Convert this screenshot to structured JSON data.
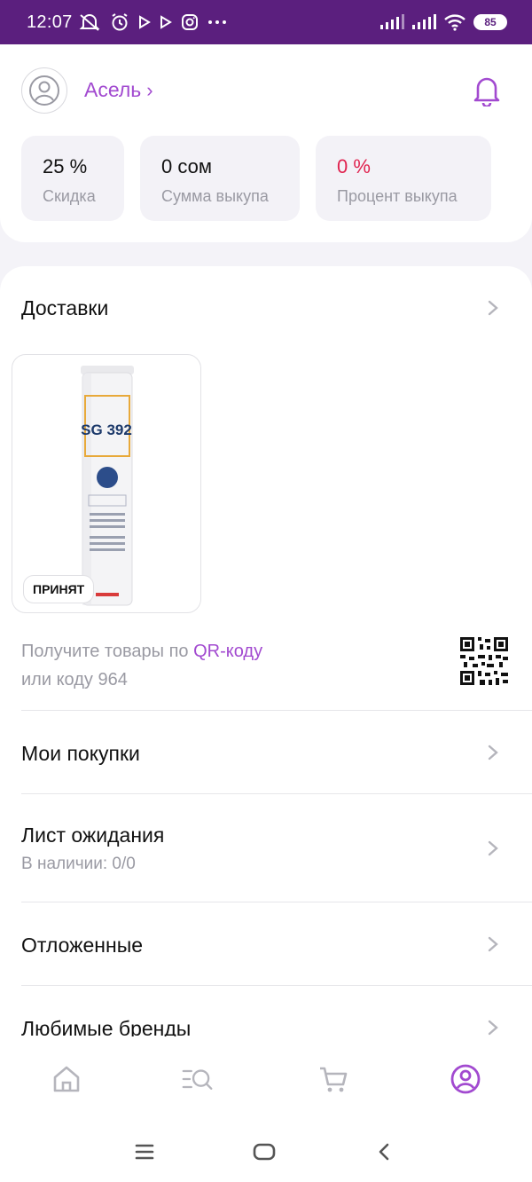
{
  "status_bar": {
    "time": "12:07",
    "battery": "85"
  },
  "profile": {
    "name": "Асель",
    "name_chevron": "›"
  },
  "stats": [
    {
      "value": "25 %",
      "label": "Скидка"
    },
    {
      "value": "0 сом",
      "label": "Сумма выкупа"
    },
    {
      "value": "0 %",
      "label": "Процент выкупа"
    }
  ],
  "deliveries": {
    "title": "Доставки",
    "item": {
      "status": "ПРИНЯТ",
      "product_text": "SG 392"
    },
    "qr_prompt_prefix": "Получите товары по ",
    "qr_link": "QR-коду",
    "qr_prompt_code": "или коду 964"
  },
  "menu": [
    {
      "title": "Мои покупки",
      "subtitle": ""
    },
    {
      "title": "Лист ожидания",
      "subtitle": "В наличии: 0/0"
    },
    {
      "title": "Отложенные",
      "subtitle": ""
    },
    {
      "title": "Любимые бренды",
      "subtitle": ""
    }
  ],
  "bottom_nav": [
    {
      "icon": "home-icon",
      "active": false
    },
    {
      "icon": "catalog-search-icon",
      "active": false
    },
    {
      "icon": "cart-icon",
      "active": false
    },
    {
      "icon": "profile-icon",
      "active": true
    }
  ],
  "colors": {
    "accent": "#a24ad0",
    "statusbar": "#5b1f7e",
    "negative": "#e0234f",
    "muted": "#9a9aa3"
  }
}
